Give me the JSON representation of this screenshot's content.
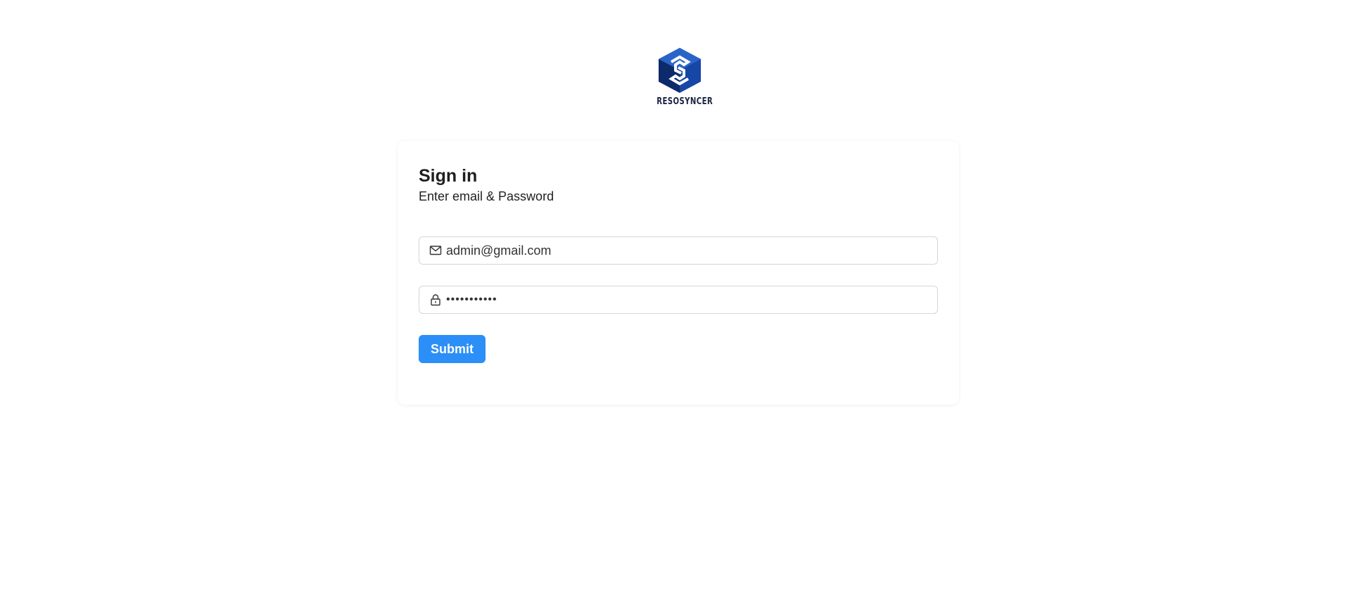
{
  "brand": {
    "logo_icon": "resosyncer-cube-logo",
    "name": "RESOSYNCER",
    "primary_color": "#1747a6",
    "dark_color": "#0d2a6b"
  },
  "signin": {
    "title": "Sign in",
    "subtitle": "Enter email & Password",
    "email": {
      "icon": "mail-icon",
      "value": "admin@gmail.com"
    },
    "password": {
      "icon": "lock-icon",
      "value": "•••••••••••"
    },
    "submit_label": "Submit",
    "accent_color": "#2b8ff7"
  }
}
